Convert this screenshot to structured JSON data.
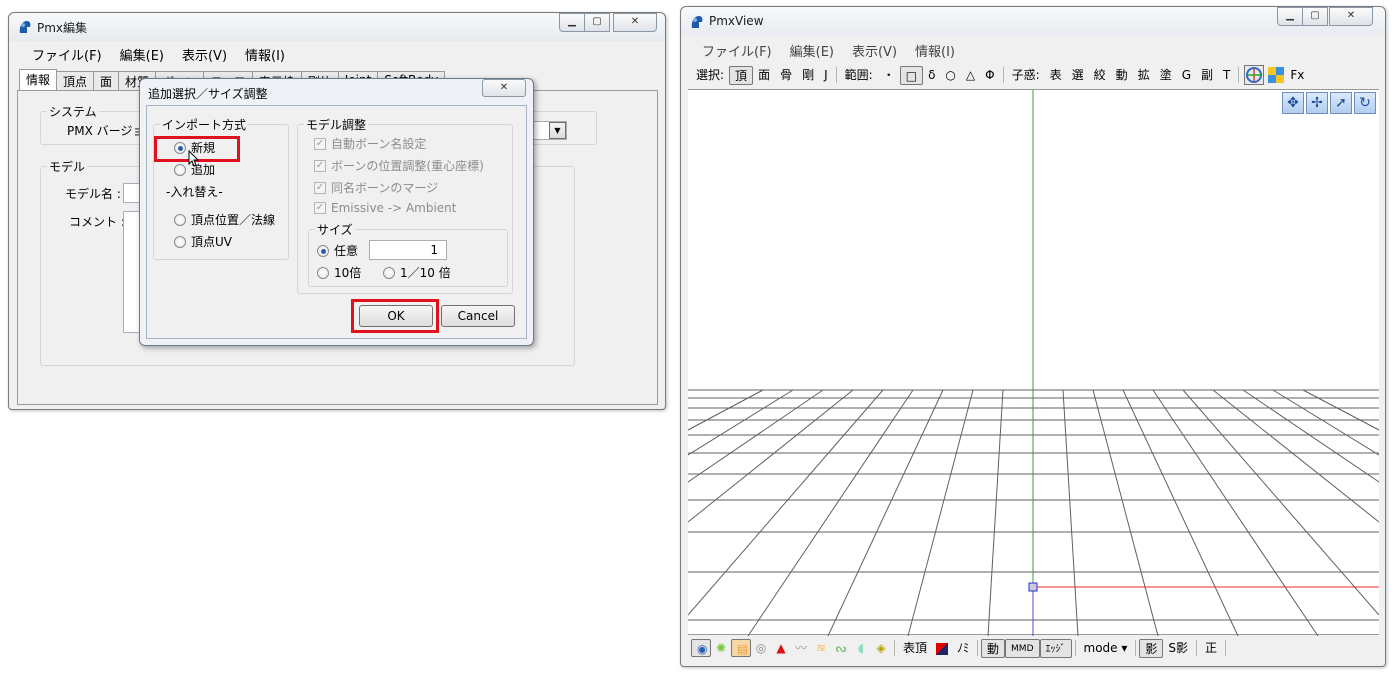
{
  "left_window": {
    "title": "Pmx編集",
    "menu": [
      "ファイル(F)",
      "編集(E)",
      "表示(V)",
      "情報(I)"
    ],
    "tabs": [
      "情報",
      "頂点",
      "面",
      "材質",
      "ボーン",
      "モーフ",
      "表示枠",
      "剛体",
      "Joint",
      "SoftBody"
    ],
    "system_group": "システム",
    "pmx_version_label": "PMX バージョン :",
    "model_group": "モデル",
    "model_name_label": "モデル名 :",
    "comment_label": "コメント :"
  },
  "dialog": {
    "title": "追加選択／サイズ調整",
    "import_group": "インポート方式",
    "radio_new": "新規",
    "radio_add": "追加",
    "replace_label": "-入れ替え-",
    "radio_vertex_pos": "頂点位置／法線",
    "radio_vertex_uv": "頂点UV",
    "model_adjust_group": "モデル調整",
    "check_auto_bone": "自動ボーン名設定",
    "check_bone_pos": "ボーンの位置調整(重心座標)",
    "check_merge_bone": "同名ボーンのマージ",
    "check_emissive": "Emissive -> Ambient",
    "size_group": "サイズ",
    "radio_custom": "任意",
    "custom_value": "1",
    "radio_10x": "10倍",
    "radio_tenth": "1／10 倍",
    "ok": "OK",
    "cancel": "Cancel",
    "close_glyph": "✕"
  },
  "right_window": {
    "title": "PmxView",
    "menu": [
      "ファイル(F)",
      "編集(E)",
      "表示(V)",
      "情報(I)"
    ],
    "toolbar": {
      "select_label": "選択:",
      "select_items": [
        "頂",
        "面",
        "骨",
        "剛",
        "J"
      ],
      "range_label": "範囲:",
      "range_items": [
        "・",
        "□",
        "δ",
        "○",
        "△",
        "Φ"
      ],
      "child_label": "子惑:",
      "child_items": [
        "表",
        "選",
        "絞",
        "動",
        "拡",
        "塗",
        "G",
        "副",
        "T"
      ],
      "fx": "Fx"
    },
    "bottom_toolbar": {
      "table_vertex": "表頂",
      "nomi": "ﾉﾐ",
      "mmd": "MMD",
      "edge": "ｴｯｼﾞ",
      "mode": "mode ▾",
      "shadow": "影",
      "s_shadow": "S影",
      "sei": "正"
    }
  },
  "colors": {
    "highlight": "#e0101e",
    "axis_y": "#3aa03a",
    "axis_x": "#e03030",
    "grid": "#555555"
  }
}
